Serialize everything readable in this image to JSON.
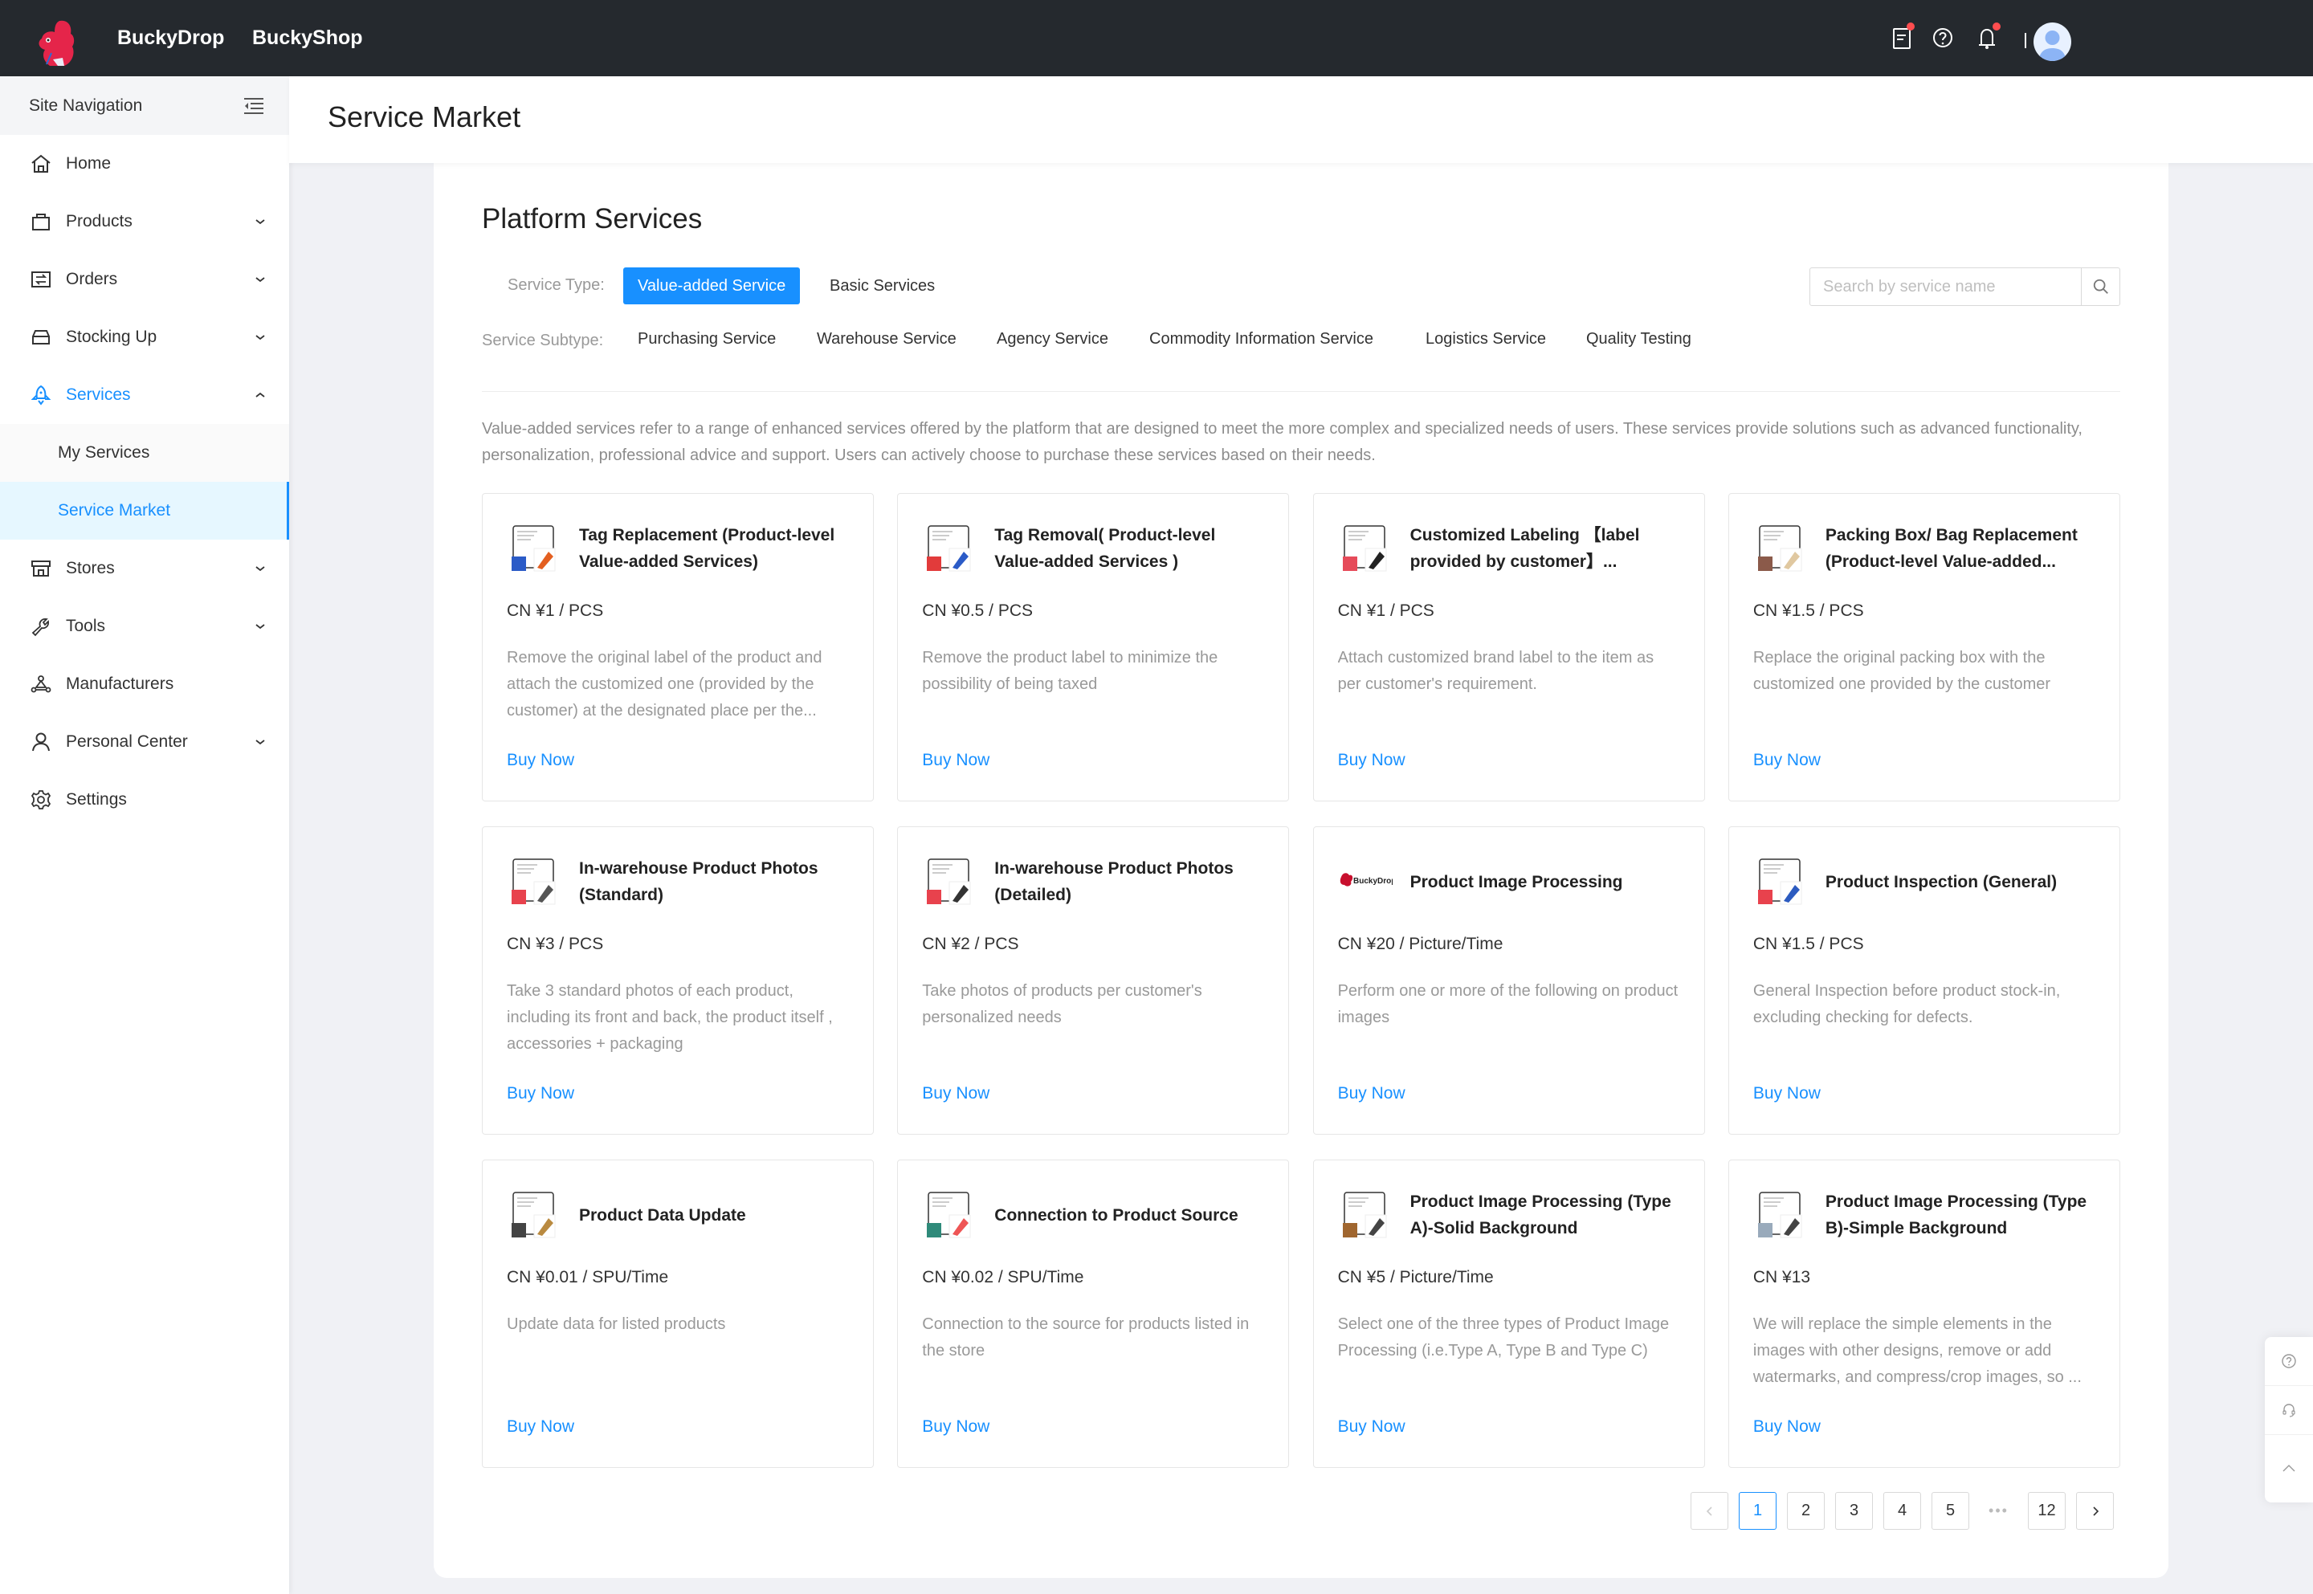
{
  "topbar": {
    "brands": [
      "BuckyDrop",
      "BuckyShop"
    ],
    "icons": [
      "tasks-icon",
      "help-icon",
      "bell-icon"
    ],
    "badge_color": "#ff4d4f"
  },
  "sidebar": {
    "header": "Site Navigation",
    "items": [
      {
        "label": "Home",
        "icon": "home-icon",
        "expandable": false
      },
      {
        "label": "Products",
        "icon": "bag-icon",
        "expandable": true
      },
      {
        "label": "Orders",
        "icon": "orders-icon",
        "expandable": true
      },
      {
        "label": "Stocking Up",
        "icon": "inbox-icon",
        "expandable": true
      },
      {
        "label": "Services",
        "icon": "rocket-icon",
        "expandable": true,
        "expanded": true,
        "active": true
      },
      {
        "label": "Stores",
        "icon": "store-icon",
        "expandable": true
      },
      {
        "label": "Tools",
        "icon": "wrench-icon",
        "expandable": true
      },
      {
        "label": "Manufacturers",
        "icon": "network-icon",
        "expandable": false
      },
      {
        "label": "Personal Center",
        "icon": "user-icon",
        "expandable": true
      },
      {
        "label": "Settings",
        "icon": "gear-icon",
        "expandable": false
      }
    ],
    "services_children": [
      {
        "label": "My Services",
        "selected": false
      },
      {
        "label": "Service Market",
        "selected": true
      }
    ],
    "accent_color": "#1890ff"
  },
  "page": {
    "title": "Service Market"
  },
  "main": {
    "section_title": "Platform Services",
    "service_type_label": "Service Type:",
    "service_types": [
      {
        "label": "Value-added Service",
        "active": true
      },
      {
        "label": "Basic Services",
        "active": false
      }
    ],
    "service_subtype_label": "Service Subtype:",
    "service_subtypes": [
      "Purchasing Service",
      "Warehouse Service",
      "Agency Service",
      "Commodity Information Service",
      "Logistics Service",
      "Quality Testing"
    ],
    "search": {
      "placeholder": "Search by service name",
      "value": ""
    },
    "intro": "Value-added services refer to a range of enhanced services offered by the platform that are designed to meet the more complex and specialized needs of users. These services provide solutions such as advanced functionality, personalization, professional advice and support. Users can actively choose to purchase these services based on their needs.",
    "buy_label": "Buy Now",
    "cards": [
      {
        "title": "Tag Replacement (Product-level Value-added Services)",
        "price": "CN ¥1 / PCS",
        "desc": "Remove the original label of the product and attach the customized one (provided by the customer) at the designated place per the...",
        "thumb": "tag-replacement"
      },
      {
        "title": "Tag Removal( Product-level Value-added Services )",
        "price": "CN ¥0.5 / PCS",
        "desc": "Remove the product label to minimize the possibility of being taxed",
        "thumb": "tag-removal"
      },
      {
        "title": "Customized Labeling 【label provided by customer】...",
        "price": "CN ¥1 / PCS",
        "desc": "Attach customized brand label to the item as per customer's requirement.",
        "thumb": "custom-label"
      },
      {
        "title": "Packing Box/ Bag Replacement (Product-level Value-added...",
        "price": "CN ¥1.5 / PCS",
        "desc": "Replace the original packing box with the customized one provided by the customer",
        "thumb": "packing-box"
      },
      {
        "title": "In-warehouse Product Photos (Standard)",
        "price": "CN ¥3 / PCS",
        "desc": "Take 3 standard photos of each product, including its front and back, the product itself , accessories + packaging",
        "thumb": "photos-standard"
      },
      {
        "title": "In-warehouse Product Photos (Detailed)",
        "price": "CN ¥2 / PCS",
        "desc": "Take photos of products per customer's personalized needs",
        "thumb": "photos-detailed"
      },
      {
        "title": "Product Image Processing",
        "price": "CN ¥20 / Picture/Time",
        "desc": "Perform one or more of the following on product images",
        "thumb": "buckydrop-logo"
      },
      {
        "title": "Product Inspection (General)",
        "price": "CN ¥1.5 / PCS",
        "desc": "General Inspection before product stock-in, excluding checking for defects.",
        "thumb": "inspection"
      },
      {
        "title": "Product Data Update",
        "price": "CN ¥0.01 / SPU/Time",
        "desc": "Update data for listed products",
        "thumb": "data-update"
      },
      {
        "title": "Connection to Product Source",
        "price": "CN ¥0.02 / SPU/Time",
        "desc": "Connection to the source for products listed in the store",
        "thumb": "product-source"
      },
      {
        "title": "Product Image Processing (Type A)-Solid Background",
        "price": "CN ¥5 / Picture/Time",
        "desc": "Select one of the three types of Product Image Processing (i.e.Type A, Type B and Type C)",
        "thumb": "image-type-a"
      },
      {
        "title": "Product Image Processing (Type B)-Simple Background",
        "price": "CN ¥13",
        "desc": "We will replace the simple elements in the images with other designs, remove or add watermarks, and compress/crop images, so ...",
        "thumb": "image-type-b"
      }
    ],
    "pagination": {
      "current": 1,
      "pages": [
        "1",
        "2",
        "3",
        "4",
        "5"
      ],
      "ellipsis": "•••",
      "last": "12"
    }
  },
  "floating": [
    "help-icon",
    "headset-icon",
    "back-to-top-icon"
  ]
}
